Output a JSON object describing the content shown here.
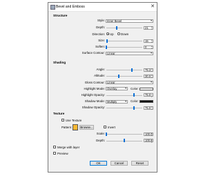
{
  "window": {
    "title": "Bevel and Emboss",
    "close_glyph": "✕"
  },
  "structure": {
    "heading": "Structure",
    "style": {
      "label": "Style:",
      "value": "Inner Bevel"
    },
    "depth": {
      "label": "Depth:",
      "value": "21",
      "slider_fraction": 0.28
    },
    "direction": {
      "label": "Direction:",
      "up": "Up",
      "down": "Down",
      "selected": "Up"
    },
    "size": {
      "label": "Size:",
      "value": "15",
      "slider_fraction": 0.03
    },
    "soften": {
      "label": "Soften:",
      "value": "0",
      "slider_fraction": 0.0
    },
    "surface_contour": {
      "label": "Surface Contour:",
      "value": "Linear"
    }
  },
  "shading": {
    "heading": "Shading",
    "angle": {
      "label": "Angle:",
      "value": "75.3",
      "slider_fraction": 0.71
    },
    "altitude": {
      "label": "Altitude:",
      "value": "30.0",
      "slider_fraction": 0.33
    },
    "gloss_contour": {
      "label": "Gloss Contour:",
      "value": "Linear"
    },
    "highlight_mode": {
      "label": "Highlight Mode:",
      "value": "Overlay",
      "color_label": "Color:",
      "color": "#ffffff"
    },
    "highlight_opacity": {
      "label": "Highlight Opacity:",
      "value": "75.0",
      "slider_fraction": 0.75
    },
    "shadow_mode": {
      "label": "Shadow Mode:",
      "value": "Multiply",
      "color_label": "Color:",
      "color": "#000000"
    },
    "shadow_opacity": {
      "label": "Shadow Opacity:",
      "value": "75.0",
      "slider_fraction": 0.75
    }
  },
  "texture": {
    "heading": "Texture",
    "use_texture": "Use Texture",
    "pattern_label": "Pattern:",
    "pattern_swatch_color": "#f7b733",
    "browse": "Browse...",
    "invert": "Invert",
    "scale": {
      "label": "Scale:",
      "value": "100.0",
      "slider_fraction": 0.0
    },
    "depth": {
      "label": "Depth:",
      "value": "100.0",
      "slider_fraction": 0.5
    }
  },
  "options": {
    "merge_with_layer": "Merge with layer",
    "preview": "Preview"
  },
  "buttons": {
    "ok": "OK",
    "cancel": "Cancel",
    "reset": "Reset"
  },
  "colors": {
    "accent": "#0a6fd6"
  }
}
